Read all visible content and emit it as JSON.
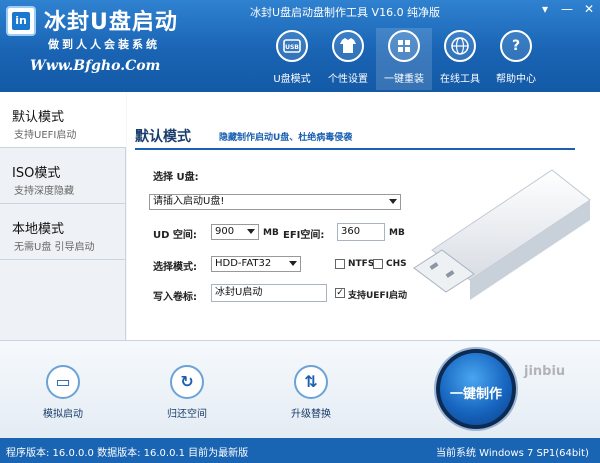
{
  "app": {
    "name": "冰封U盘启动",
    "slogan": "做到人人会装系统",
    "site": "Www.Bfgho.Com",
    "window_title": "冰封U盘启动盘制作工具 V16.0 纯净版"
  },
  "window_controls": {
    "menu": "▾",
    "minimize": "—",
    "close": "✕"
  },
  "toolbar": {
    "items": [
      {
        "label": "U盘模式",
        "icon": "usb-icon"
      },
      {
        "label": "个性设置",
        "icon": "shirt-icon"
      },
      {
        "label": "一键重装",
        "icon": "windows-icon"
      },
      {
        "label": "在线工具",
        "icon": "globe-icon"
      },
      {
        "label": "帮助中心",
        "icon": "help-icon"
      }
    ]
  },
  "sidebar": {
    "tabs": [
      {
        "title": "默认模式",
        "desc": "支持UEFI启动",
        "active": true
      },
      {
        "title": "ISO模式",
        "desc": "支持深度隐藏"
      },
      {
        "title": "本地模式",
        "desc": "无需U盘 引导启动"
      }
    ]
  },
  "main": {
    "title": "默认模式",
    "subtitle": "隐藏制作启动U盘、杜绝病毒侵袭",
    "select_disk_label": "选择 U盘:",
    "select_disk_value": "请插入启动U盘!",
    "ud_space_label": "UD 空间:",
    "ud_space_value": "900",
    "ud_unit": "MB",
    "efi_space_label": "EFI空间:",
    "efi_space_value": "360",
    "efi_unit": "MB",
    "mode_label": "选择模式:",
    "mode_value": "HDD-FAT32",
    "ntfs_label": "NTFS",
    "chs_label": "CHS",
    "volume_label": "写入卷标:",
    "volume_value": "冰封U启动",
    "uefi_label": "支持UEFI启动",
    "uefi_checked": "✓"
  },
  "bottom": {
    "simulate": "模拟启动",
    "restore": "归还空间",
    "upgrade": "升级替换",
    "make": "一键制作"
  },
  "status": {
    "left": "程序版本: 16.0.0.0 数据版本: 16.0.0.1 目前为最新版",
    "right": "当前系统 Windows 7 SP1(64bit)"
  },
  "watermark": "jinbiu"
}
